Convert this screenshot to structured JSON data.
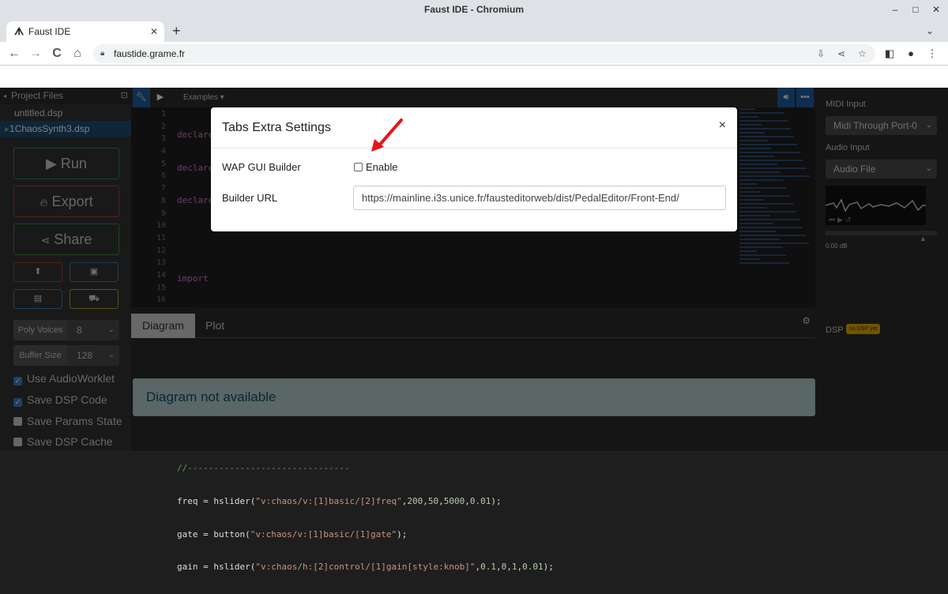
{
  "window": {
    "title": "Faust IDE - Chromium",
    "minimize": "–",
    "maximize": "□",
    "close": "✕"
  },
  "browser": {
    "tab_title": "Faust IDE",
    "tab_close": "✕",
    "new_tab": "+",
    "tab_menu": "⌄",
    "url": "faustide.grame.fr",
    "back": "←",
    "forward": "→",
    "reload": "C",
    "home": "⌂"
  },
  "sidebar": {
    "header": "Project Files",
    "files": [
      {
        "name": "untitled.dsp"
      },
      {
        "name": "1ChaosSynth3.dsp"
      }
    ],
    "run": "Run",
    "export": "Export",
    "share": "Share",
    "poly_label": "Poly Voices",
    "poly_value": "8",
    "buffer_label": "Buffer Size",
    "buffer_value": "128",
    "options": [
      {
        "label": "Use AudioWorklet",
        "checked": true
      },
      {
        "label": "Save DSP Code",
        "checked": true
      },
      {
        "label": "Save Params State",
        "checked": false
      },
      {
        "label": "Save DSP Cache",
        "checked": false
      }
    ]
  },
  "editor": {
    "examples": "Examples ▾",
    "line_numbers": [
      "1",
      "2",
      "3",
      "4",
      "5",
      "6",
      "7",
      "8",
      "9",
      "10",
      "11",
      "12",
      "13",
      "14",
      "15",
      "16"
    ]
  },
  "bottom": {
    "tab_diagram": "Diagram",
    "tab_plot": "Plot",
    "alert": "Diagram not available"
  },
  "right_panel": {
    "midi_label": "MIDI Input",
    "midi_value": "Midi Through Port-0",
    "audio_label": "Audio Input",
    "audio_value": "Audio File",
    "gain": "0.00 dB",
    "dsp_label": "DSP",
    "dsp_badge": "no DSP yet"
  },
  "modal": {
    "title": "Tabs Extra Settings",
    "close": "×",
    "wap_label": "WAP GUI Builder",
    "enable_label": "Enable",
    "enable_checked": false,
    "url_label": "Builder URL",
    "url_value": "https://mainline.i3s.unice.fr/fausteditorweb/dist/PedalEditor/Front-End/"
  },
  "colors": {
    "run_border": "#5cb85c",
    "export_border": "#d9534f",
    "accent_blue": "#1f4a70",
    "alert_bg": "#b6cdcf",
    "annotation_arrow": "#e8141b"
  }
}
